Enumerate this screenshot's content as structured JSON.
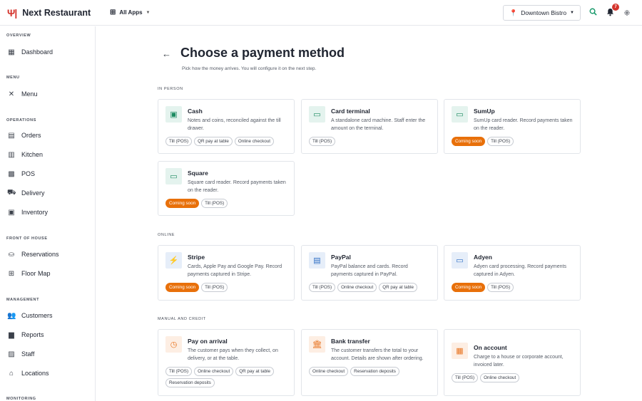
{
  "brand": {
    "name": "Next Restaurant",
    "icon": "fork-knife-icon"
  },
  "header": {
    "apps_label": "All Apps",
    "location": "Downtown Bistro",
    "notifications_count": "7"
  },
  "sidebar": {
    "sections": [
      {
        "title": "OVERVIEW",
        "items": [
          {
            "label": "Dashboard",
            "icon": "dashboard-icon"
          }
        ]
      },
      {
        "title": "MENU",
        "items": [
          {
            "label": "Menu",
            "icon": "utensils-icon"
          }
        ]
      },
      {
        "title": "OPERATIONS",
        "items": [
          {
            "label": "Orders",
            "icon": "receipt-icon"
          },
          {
            "label": "Kitchen",
            "icon": "kitchen-icon"
          },
          {
            "label": "POS",
            "icon": "register-icon"
          },
          {
            "label": "Delivery",
            "icon": "truck-icon"
          },
          {
            "label": "Inventory",
            "icon": "box-icon"
          }
        ]
      },
      {
        "title": "FRONT OF HOUSE",
        "items": [
          {
            "label": "Reservations",
            "icon": "table-icon"
          },
          {
            "label": "Floor Map",
            "icon": "floor-map-icon"
          }
        ]
      },
      {
        "title": "MANAGEMENT",
        "items": [
          {
            "label": "Customers",
            "icon": "people-icon"
          },
          {
            "label": "Reports",
            "icon": "chart-icon"
          },
          {
            "label": "Staff",
            "icon": "badge-icon"
          },
          {
            "label": "Locations",
            "icon": "store-icon"
          }
        ]
      },
      {
        "title": "MONITORING",
        "items": []
      }
    ]
  },
  "page": {
    "title": "Choose a payment method",
    "subtitle": "Pick how the money arrives. You will configure it on the next step."
  },
  "groups": [
    {
      "title": "IN PERSON",
      "cards": [
        {
          "title": "Cash",
          "desc": "Notes and coins, reconciled against the till drawer.",
          "icon": "cash-icon",
          "tags": [
            "Till (POS)",
            "QR pay at table",
            "Online checkout"
          ],
          "coming_soon": ""
        },
        {
          "title": "Card terminal",
          "desc": "A standalone card machine. Staff enter the amount on the terminal.",
          "icon": "card-icon",
          "tags": [
            "Till (POS)"
          ],
          "coming_soon": ""
        },
        {
          "title": "SumUp",
          "desc": "SumUp card reader. Record payments taken on the reader.",
          "icon": "card-icon",
          "tags": [
            "Till (POS)"
          ],
          "coming_soon": "Coming soon"
        },
        {
          "title": "Square",
          "desc": "Square card reader. Record payments taken on the reader.",
          "icon": "card-icon",
          "tags": [
            "Till (POS)"
          ],
          "coming_soon": "Coming soon"
        }
      ]
    },
    {
      "title": "ONLINE",
      "cards": [
        {
          "title": "Stripe",
          "desc": "Cards, Apple Pay and Google Pay. Record payments captured in Stripe.",
          "icon": "bolt-icon",
          "tags": [
            "Till (POS)"
          ],
          "coming_soon": "Coming soon"
        },
        {
          "title": "PayPal",
          "desc": "PayPal balance and cards. Record payments captured in PayPal.",
          "icon": "wallet-icon",
          "tags": [
            "Till (POS)",
            "Online checkout",
            "QR pay at table"
          ],
          "coming_soon": ""
        },
        {
          "title": "Adyen",
          "desc": "Adyen card processing. Record payments captured in Adyen.",
          "icon": "card-icon",
          "tags": [
            "Till (POS)"
          ],
          "coming_soon": "Coming soon"
        }
      ]
    },
    {
      "title": "MANUAL AND CREDIT",
      "cards": [
        {
          "title": "Pay on arrival",
          "desc": "The customer pays when they collect, on delivery, or at the table.",
          "icon": "clock-icon",
          "tags": [
            "Till (POS)",
            "Online checkout",
            "QR pay at table",
            "Reservation deposits"
          ],
          "coming_soon": ""
        },
        {
          "title": "Bank transfer",
          "desc": "The customer transfers the total to your account. Details are shown after ordering.",
          "icon": "bank-icon",
          "tags": [
            "Online checkout",
            "Reservation deposits"
          ],
          "coming_soon": ""
        },
        {
          "title": "On account",
          "desc": "Charge to a house or corporate account, invoiced later.",
          "icon": "briefcase-icon",
          "tags": [
            "Till (POS)",
            "Online checkout"
          ],
          "coming_soon": ""
        }
      ]
    }
  ]
}
